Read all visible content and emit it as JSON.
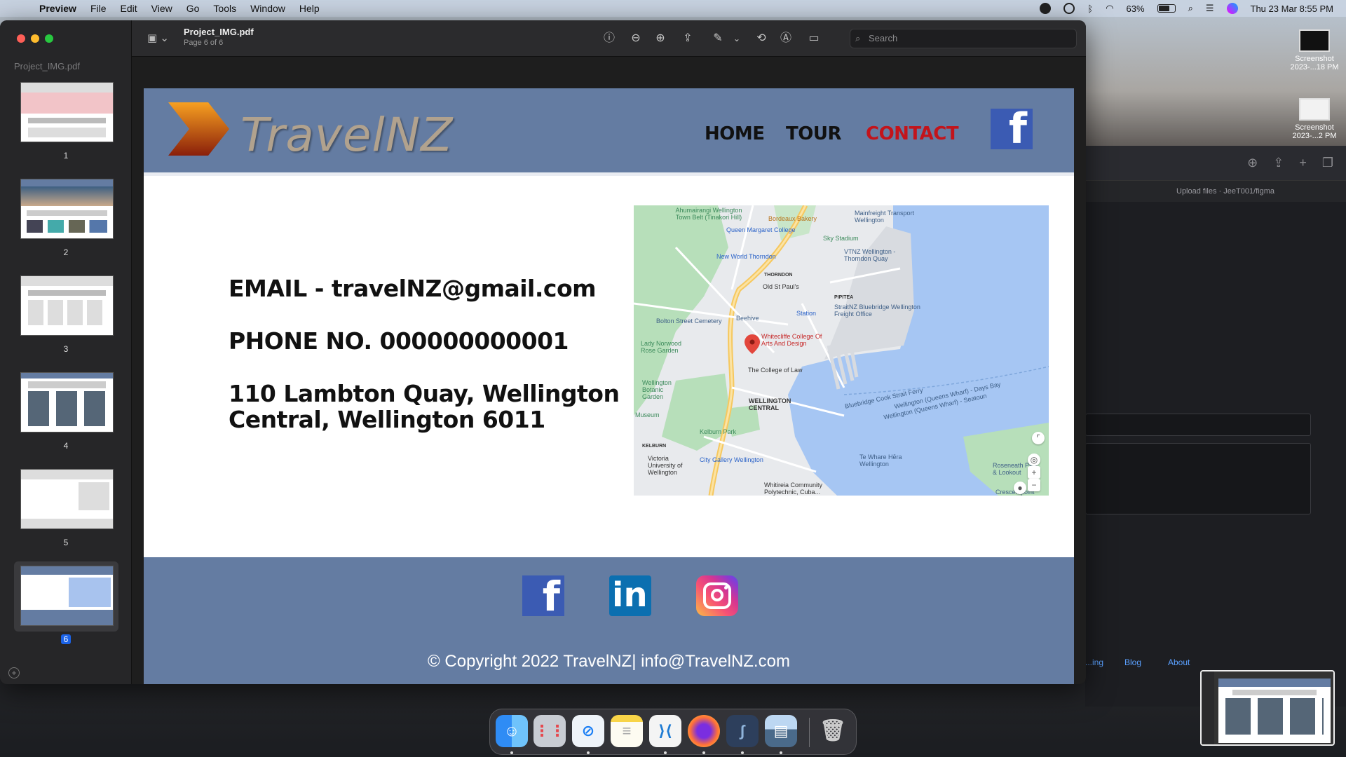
{
  "menubar": {
    "app": "Preview",
    "items": [
      "File",
      "Edit",
      "View",
      "Go",
      "Tools",
      "Window",
      "Help"
    ],
    "battery": "63%",
    "datetime": "Thu 23 Mar  8:55 PM"
  },
  "desktop": {
    "files": [
      {
        "label": "Screenshot 2023-...18 PM"
      },
      {
        "label": "Screenshot 2023-...2 PM"
      }
    ]
  },
  "background_window": {
    "tab_label": "Upload files · JeeT001/figma",
    "links": [
      "...ing",
      "Blog",
      "About"
    ]
  },
  "preview": {
    "sidebar_title": "Project_IMG.pdf",
    "pages": [
      "1",
      "2",
      "3",
      "4",
      "5",
      "6"
    ],
    "selected_page": "6",
    "doc_title": "Project_IMG.pdf",
    "doc_page": "Page 6 of 6",
    "search_placeholder": "Search"
  },
  "site": {
    "logo": "TravelNZ",
    "nav": [
      "HOME",
      "TOUR",
      "CONTACT"
    ],
    "active_nav": "CONTACT",
    "email": "EMAIL - travelNZ@gmail.com",
    "phone": "PHONE NO. 000000000001",
    "address_line1": "110 Lambton Quay, Wellington",
    "address_line2": "Central, Wellington 6011",
    "copyright": "© Copyright 2022 TravelNZ| info@TravelNZ.com",
    "colors": {
      "header_bg": "#647ca2",
      "active_nav": "#c3141b",
      "logo_text": "#b1a28e"
    }
  },
  "map": {
    "labels": [
      "Ahumairangi Wellington Town Belt (Tinakori Hill)",
      "Bordeaux Bakery",
      "Mainfreight Transport Wellington",
      "Queen Margaret College",
      "Sky Stadium",
      "New World Thorndon",
      "VTNZ Wellington - Thorndon Quay",
      "THORNDON",
      "Old St Paul's",
      "PIPITEA",
      "StraitNZ Bluebridge Wellington Freight Office",
      "Bolton Street Cemetery",
      "Beehive",
      "Station",
      "Whitecliffe College Of Arts And Design",
      "Lady Norwood Rose Garden",
      "The College of Law",
      "Wellington Botanic Garden",
      "WELLINGTON CENTRAL",
      "Museum",
      "Kelburn Park",
      "KELBURN",
      "Victoria University of Wellington",
      "City Gallery Wellington",
      "Te Whare Hēra Wellington",
      "Whitireia Community Polytechnic, Cuba...",
      "Bluebridge Cook Strait Ferry",
      "Wellington (Queens Wharf) - Days Bay",
      "Wellington (Queens Wharf) - Seatoun",
      "Roseneath Park & Lookout",
      "Crescentpoint"
    ]
  }
}
